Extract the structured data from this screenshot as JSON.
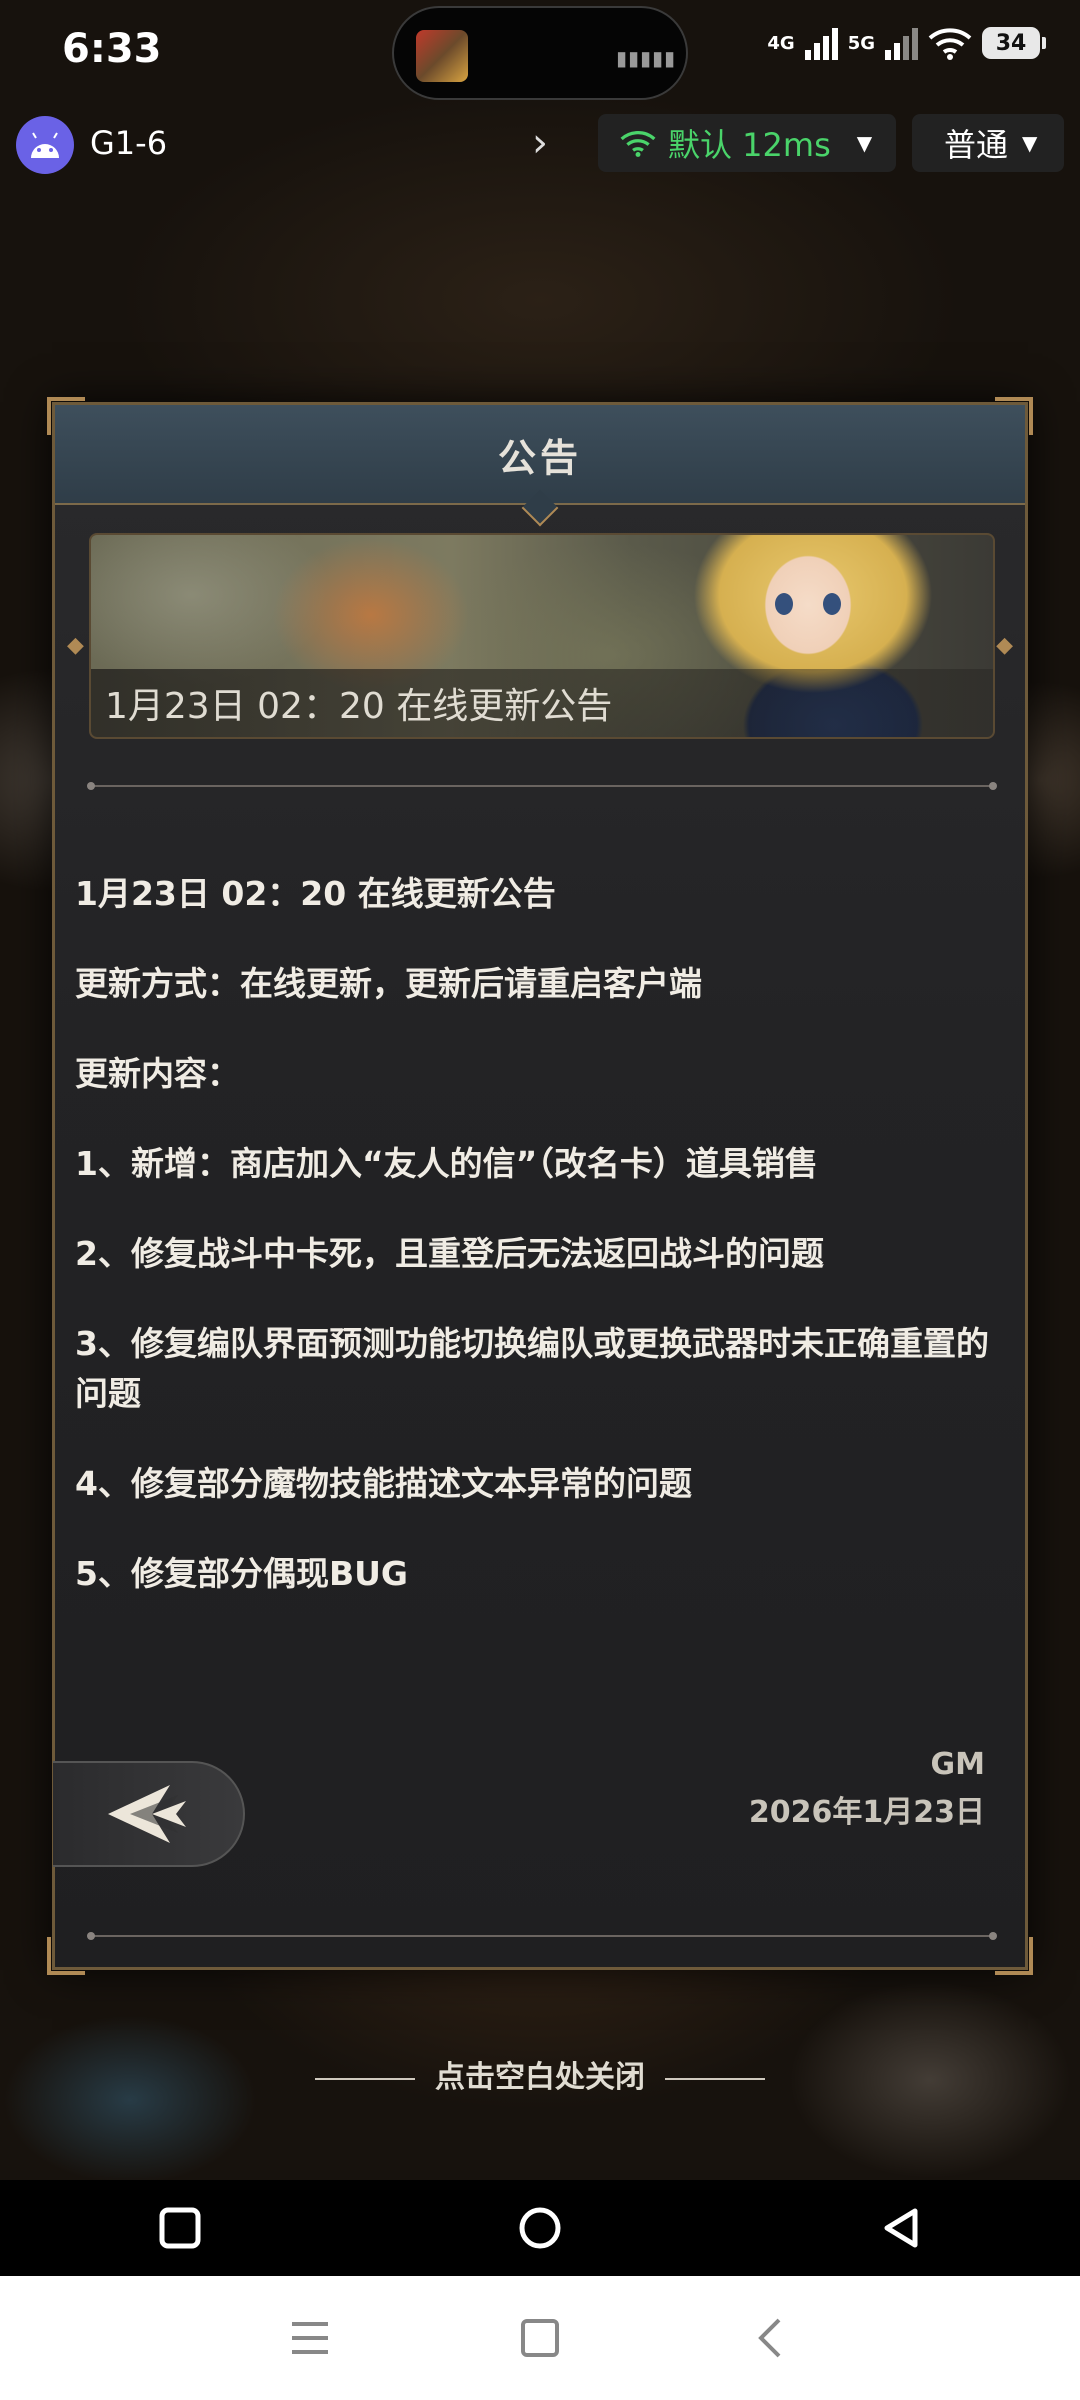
{
  "status_bar": {
    "time": "6:33",
    "network_1": "4G",
    "network_2": "5G",
    "battery": "34"
  },
  "app_bar": {
    "device_name": "G1-6",
    "network_chip_label": "默认 12ms",
    "mode_chip_label": "普通"
  },
  "dialog": {
    "title": "公告",
    "banner_caption": "1月23日 02：20 在线更新公告",
    "paragraphs": [
      "1月23日 02：20 在线更新公告",
      "更新方式：在线更新，更新后请重启客户端",
      "更新内容：",
      "1、新增：商店加入“友人的信”（改名卡）道具销售",
      "2、修复战斗中卡死，且重登后无法返回战斗的问题",
      "3、修复编队界面预测功能切换编队或更换武器时未正确重置的问题",
      "4、修复部分魔物技能描述文本异常的问题",
      "5、修复部分偶现BUG"
    ],
    "signature_author": "GM",
    "signature_date": "2026年1月23日"
  },
  "dismiss_hint": "点击空白处关闭",
  "colors": {
    "accent_green": "#4ad46a",
    "frame_gold": "#b08a55",
    "header_slate": "#3e4f5c"
  },
  "icons": {
    "avatar": "android-icon",
    "chevron": "chevron-right-icon",
    "wifi": "wifi-icon",
    "back": "back-arrow-icon",
    "nav_recents": "square-icon",
    "nav_home": "circle-icon",
    "nav_back": "triangle-back-icon",
    "menu": "menu-icon"
  }
}
